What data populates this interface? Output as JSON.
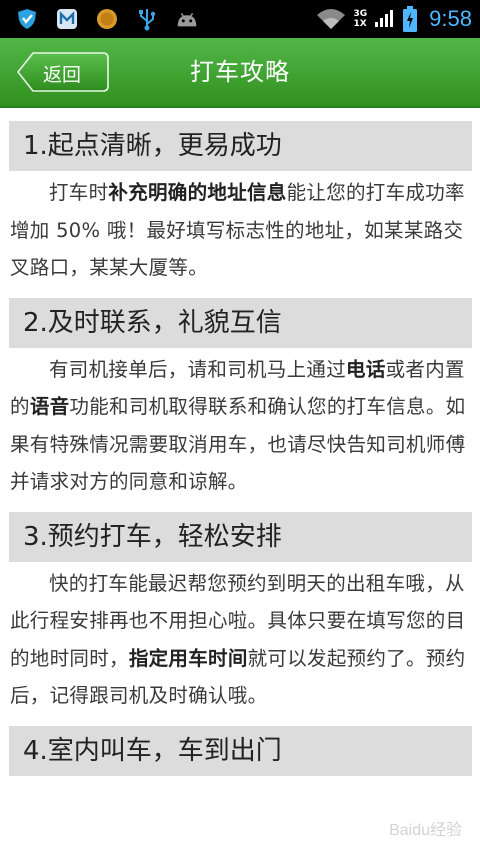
{
  "statusbar": {
    "network_top": "3G",
    "network_bottom": "1X",
    "time": "9:58"
  },
  "header": {
    "back_label": "返回",
    "title": "打车攻略"
  },
  "sections": [
    {
      "heading": "1.起点清晰，更易成功",
      "parts": [
        "打车时",
        "补充明确的地址信息",
        "能让您的打车成功率增加 50% 哦！最好填写标志性的地址，如某某路交叉路口，某某大厦等。"
      ]
    },
    {
      "heading": "2.及时联系，礼貌互信",
      "parts": [
        "有司机接单后，请和司机马上通过",
        "电话",
        "或者内置的",
        "语音",
        "功能和司机取得联系和确认您的打车信息。如果有特殊情况需要取消用车，也请尽快告知司机师傅并请求对方的同意和谅解。"
      ]
    },
    {
      "heading": "3.预约打车，轻松安排",
      "parts": [
        "快的打车能最迟帮您预约到明天的出租车哦，从此行程安排再也不用担心啦。具体只要在填写您的目的地时同时，",
        "指定用车时间",
        "就可以发起预约了。预约后，记得跟司机及时确认哦。"
      ]
    },
    {
      "heading": "4.室内叫车，车到出门"
    }
  ],
  "watermark": "Baidu经验",
  "colors": {
    "header_green": "#3da332",
    "section_bg": "#dcdcdc",
    "time_blue": "#4fb6ff"
  },
  "icons": [
    "shield-icon",
    "m-app-icon",
    "coin-icon",
    "usb-icon",
    "android-icon",
    "wifi-icon",
    "signal-icon",
    "battery-icon",
    "back-arrow-icon"
  ]
}
